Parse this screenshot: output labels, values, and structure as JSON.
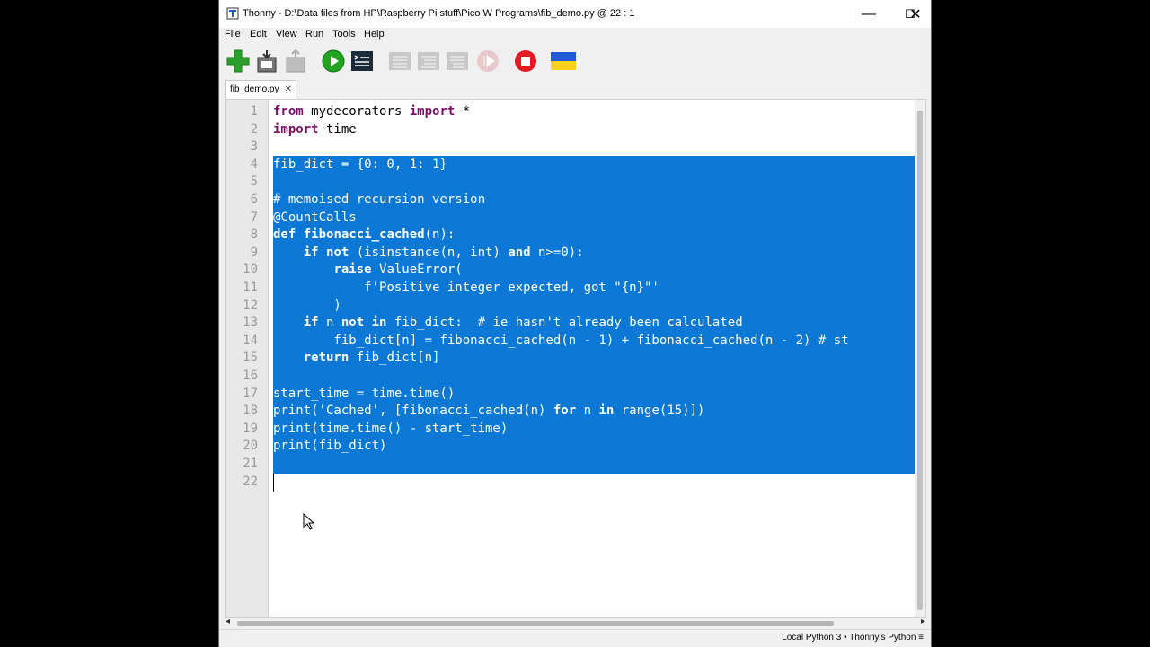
{
  "window": {
    "title": "Thonny  -  D:\\Data files from HP\\Raspberry Pi stuff\\Pico W Programs\\fib_demo.py  @  22 : 1",
    "app_icon": "thonny-icon"
  },
  "menu": [
    "File",
    "Edit",
    "View",
    "Run",
    "Tools",
    "Help"
  ],
  "toolbar": {
    "buttons": [
      "new-file-icon",
      "save-file-icon",
      "open-file-icon",
      "run-icon",
      "debug-icon",
      "step-over-icon",
      "step-into-icon",
      "step-out-icon",
      "resume-icon",
      "stop-icon",
      "ukraine-flag-icon"
    ]
  },
  "tab": {
    "label": "fib_demo.py",
    "close": "✕"
  },
  "editor": {
    "line_numbers": [
      "1",
      "2",
      "3",
      "4",
      "5",
      "6",
      "7",
      "8",
      "9",
      "10",
      "11",
      "12",
      "13",
      "14",
      "15",
      "16",
      "17",
      "18",
      "19",
      "20",
      "21",
      "22"
    ],
    "selection": "lines 4-21",
    "caret": "22 : 1"
  },
  "status": {
    "text": "Local Python 3  •  Thonny's Python  ≡"
  },
  "colors": {
    "selection": "#0a78d4",
    "keyword": "#7d0d64"
  }
}
